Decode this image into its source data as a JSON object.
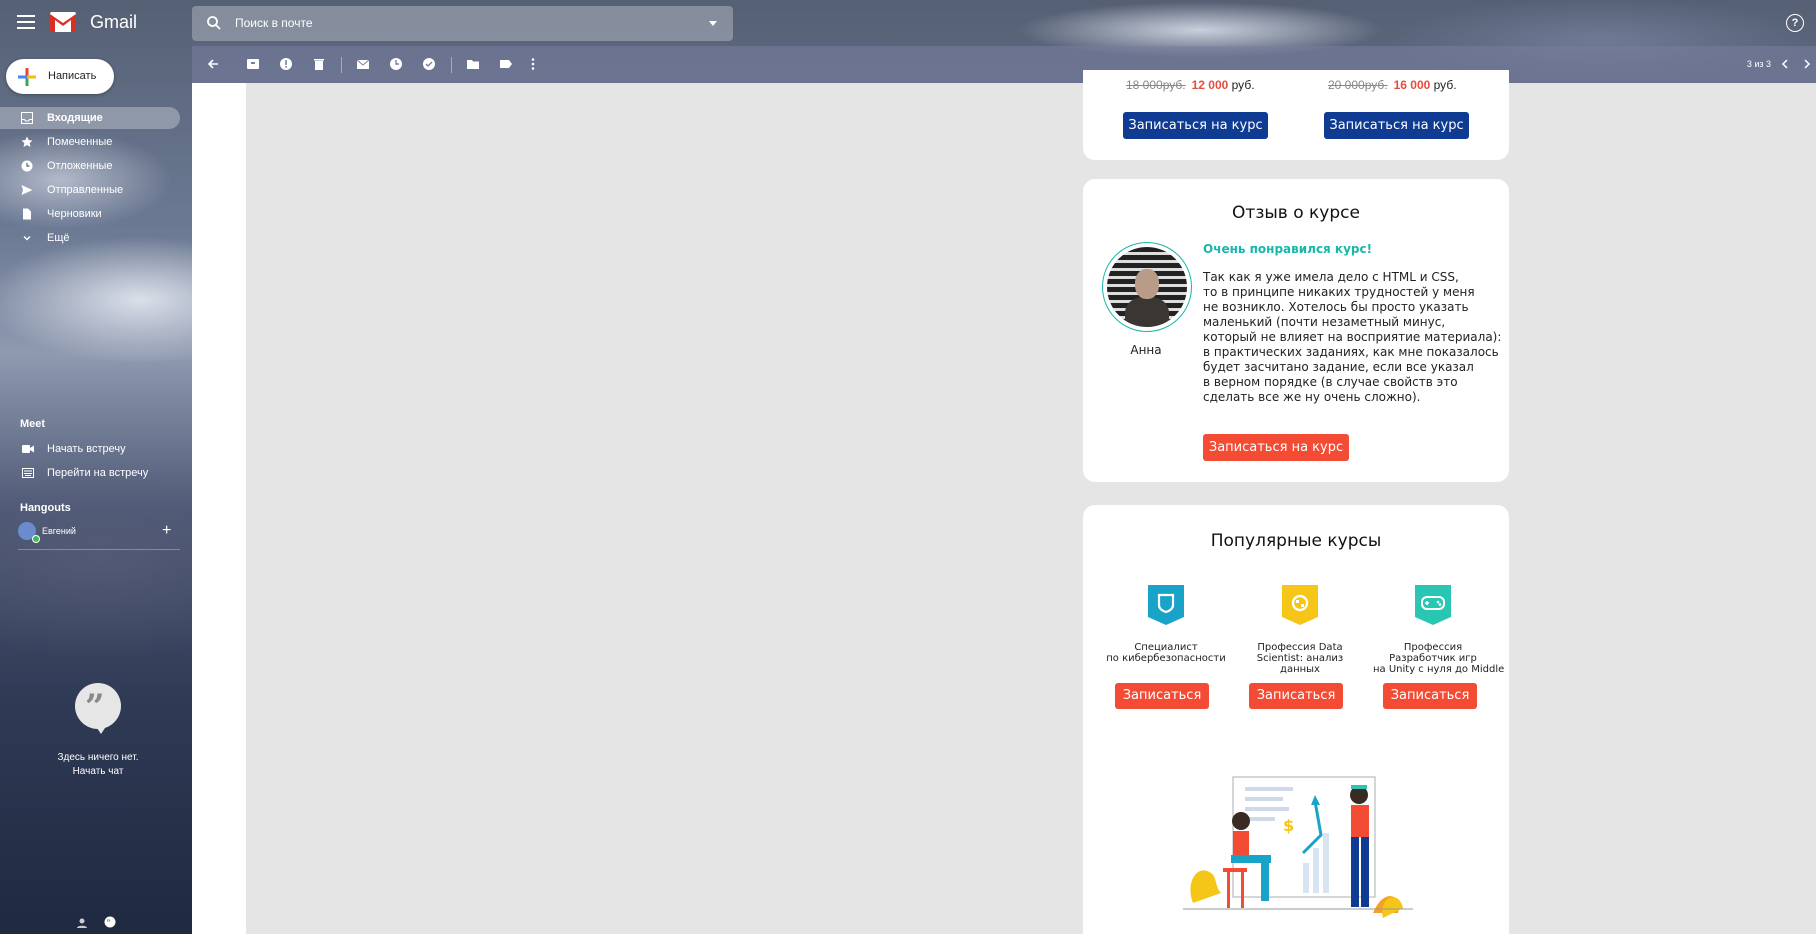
{
  "app": {
    "name": "Gmail"
  },
  "search": {
    "placeholder": "Поиск в почте"
  },
  "compose": {
    "label": "Написать"
  },
  "nav": [
    {
      "label": "Входящие",
      "icon": "inbox-icon",
      "active": true
    },
    {
      "label": "Помеченные",
      "icon": "star-icon"
    },
    {
      "label": "Отложенные",
      "icon": "clock-icon"
    },
    {
      "label": "Отправленные",
      "icon": "send-icon"
    },
    {
      "label": "Черновики",
      "icon": "draft-icon"
    },
    {
      "label": "Ещё",
      "icon": "chevron-down-icon"
    }
  ],
  "meet": {
    "title": "Meet",
    "items": [
      {
        "label": "Начать встречу",
        "icon": "video-icon"
      },
      {
        "label": "Перейти на встречу",
        "icon": "keyboard-icon"
      }
    ]
  },
  "hangouts": {
    "title": "Hangouts",
    "user": "Евгений",
    "empty_line1": "Здесь ничего нет.",
    "empty_line2": "Начать чат"
  },
  "toolbar": {
    "count": "3 из 3"
  },
  "email": {
    "prices": [
      {
        "old": "18 000руб.",
        "new": "12 000",
        "unit": "руб."
      },
      {
        "old": "20 000руб.",
        "new": "16 000",
        "unit": "руб."
      }
    ],
    "enroll_label": "Записаться на курс",
    "review": {
      "title": "Отзыв о курсе",
      "name": "Анна",
      "headline": "Очень понравился курс!",
      "text": "Так как я уже имела дело с HTML и CSS,\nто в принципе никаких трудностей у меня\nне возникло. Хотелось бы просто указать\nмаленький (почти незаметный минус,\nкоторый не влияет на восприятие материала):\nв практических заданиях, как мне показалось\nбудет засчитано задание, если все указал\nв верном порядке (в случае свойств это\nсделать все же ну очень сложно).",
      "button": "Записаться на курс"
    },
    "popular": {
      "title": "Популярные курсы",
      "courses": [
        {
          "title": "Специалист\nпо кибербезопасности",
          "button": "Записаться",
          "color": "#1aa3c9"
        },
        {
          "title": "Профессия Data\nScientist: анализ\nданных",
          "button": "Записаться",
          "color": "#f5c518"
        },
        {
          "title": "Профессия\nРазработчик игр\nна Unity с нуля до Middle",
          "button": "Записаться",
          "color": "#29c7b3"
        }
      ]
    }
  },
  "colors": {
    "accent_red": "#f44b35",
    "accent_blue": "#0f3b93",
    "teal": "#18b7a8"
  }
}
